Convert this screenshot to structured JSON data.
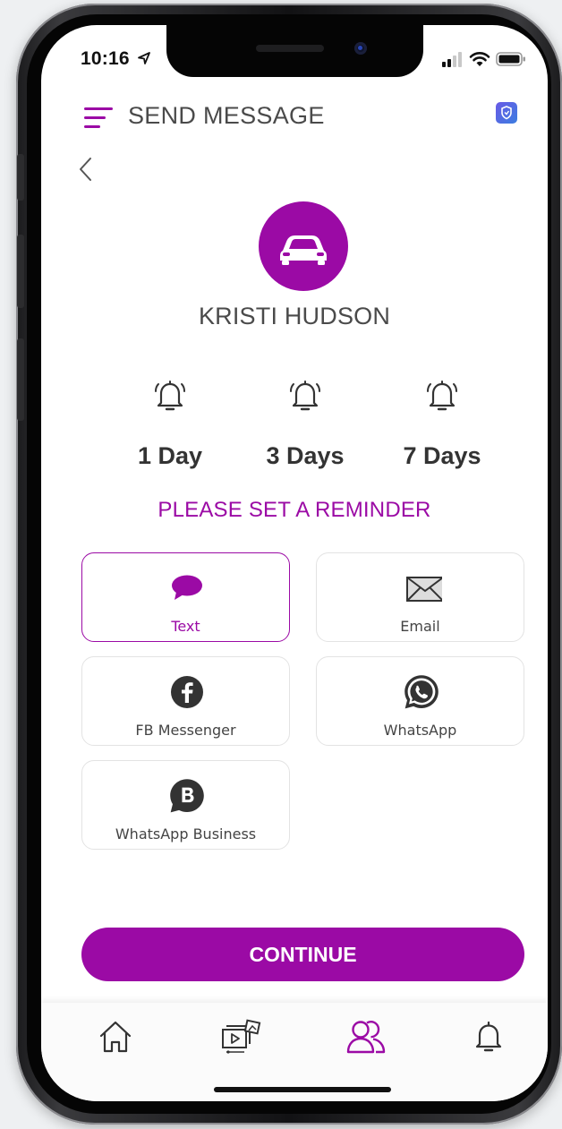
{
  "status_bar": {
    "time": "10:16"
  },
  "header": {
    "title": "SEND MESSAGE"
  },
  "contact": {
    "name": "KRISTI HUDSON"
  },
  "reminders": [
    {
      "label": "1 Day"
    },
    {
      "label": "3 Days"
    },
    {
      "label": "7 Days"
    }
  ],
  "prompt": "PLEASE SET A REMINDER",
  "options": [
    {
      "label": "Text",
      "icon": "chat-bubble-icon",
      "selected": true
    },
    {
      "label": "Email",
      "icon": "envelope-icon",
      "selected": false
    },
    {
      "label": "FB Messenger",
      "icon": "facebook-icon",
      "selected": false
    },
    {
      "label": "WhatsApp",
      "icon": "whatsapp-icon",
      "selected": false
    },
    {
      "label": "WhatsApp Business",
      "icon": "whatsapp-business-icon",
      "selected": false
    }
  ],
  "continue_label": "CONTINUE",
  "tabbar": {
    "tabs": [
      {
        "name": "home",
        "icon": "home-icon",
        "active": false
      },
      {
        "name": "media",
        "icon": "media-icon",
        "active": false
      },
      {
        "name": "contacts",
        "icon": "contacts-icon",
        "active": true
      },
      {
        "name": "notifications",
        "icon": "bell-icon",
        "active": false
      }
    ]
  },
  "colors": {
    "accent": "#9b0aa5",
    "text": "#4a4a4a",
    "icon": "#333333"
  }
}
